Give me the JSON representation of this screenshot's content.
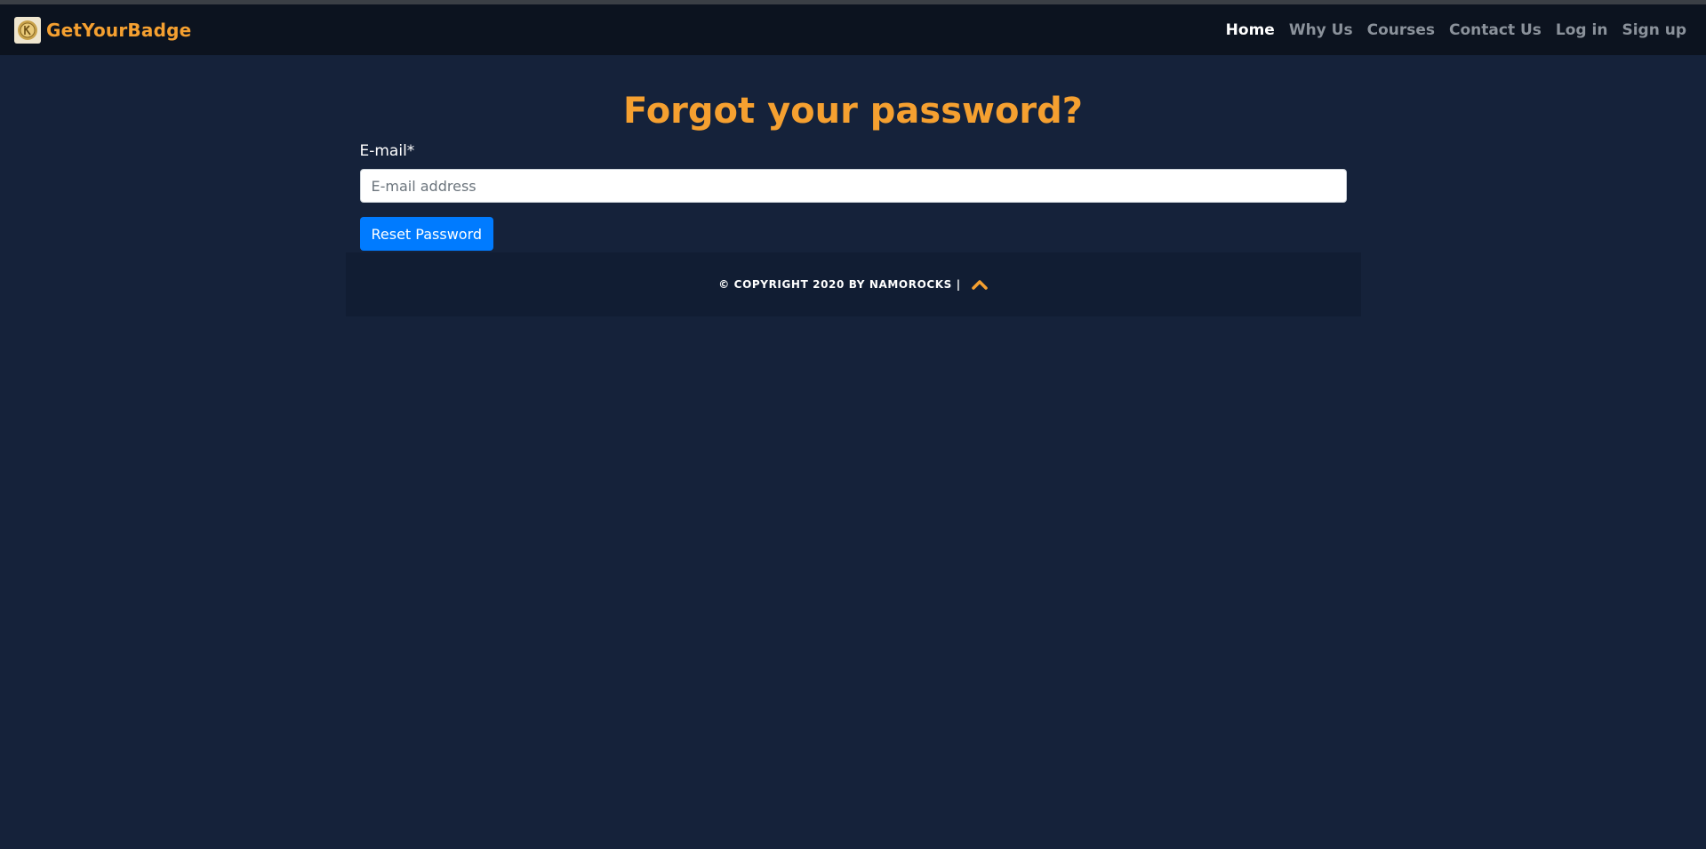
{
  "navbar": {
    "brand": "GetYourBadge",
    "links": [
      {
        "label": "Home",
        "active": true
      },
      {
        "label": "Why Us",
        "active": false
      },
      {
        "label": "Courses",
        "active": false
      },
      {
        "label": "Contact Us",
        "active": false
      },
      {
        "label": "Log in",
        "active": false
      },
      {
        "label": "Sign up",
        "active": false
      }
    ]
  },
  "main": {
    "title": "Forgot your password?",
    "email_label": "E-mail*",
    "email_placeholder": "E-mail address",
    "email_value": "",
    "submit_label": "Reset Password"
  },
  "footer": {
    "copyright": "© COPYRIGHT 2020 BY NAMOROCKS |",
    "up_icon": "chevron-up-icon"
  },
  "colors": {
    "accent": "#f5a030",
    "background": "#15223a",
    "navbar": "#0c131f",
    "button": "#007bff"
  }
}
